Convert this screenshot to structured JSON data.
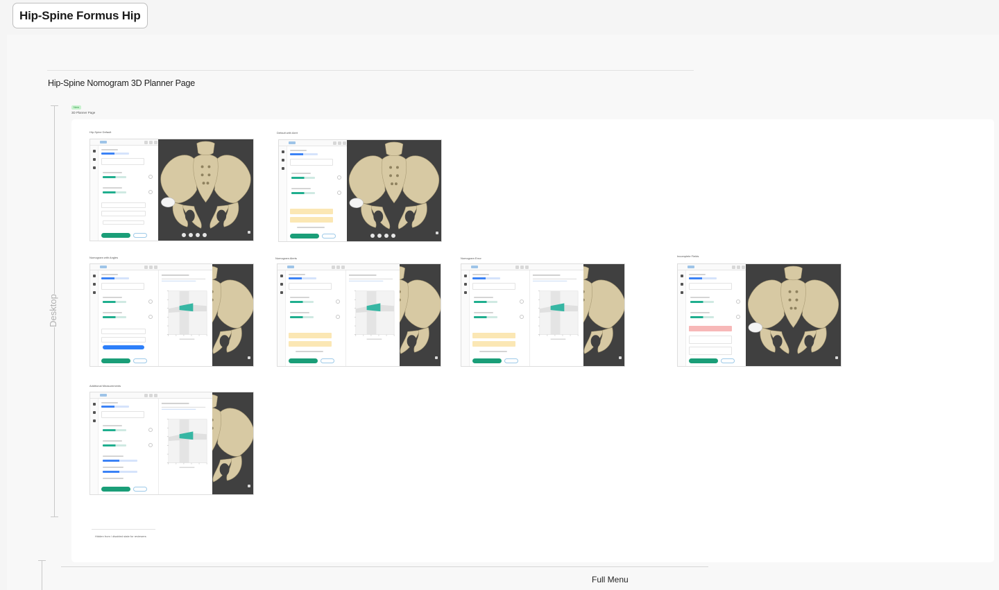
{
  "page": {
    "title": "Hip-Spine Formus Hip",
    "section_title": "Hip-Spine Nomogram 3D Planner Page",
    "vertical_label": "Desktop",
    "status_badge": "New",
    "page_label": "3D Planner Page",
    "footnote": "Hidden from / disabled state for reviewers",
    "next_section_label": "Full Menu"
  },
  "colors": {
    "accent_teal": "#1a9e78",
    "accent_blue": "#2d7ff9",
    "warning_yellow": "#fbe7b4",
    "error_red": "#f7b8b8",
    "viewer_bg": "#404040",
    "bone": "#d7c9a3"
  },
  "frames": [
    {
      "label": "Hip-Spine Default",
      "variant": "default"
    },
    {
      "label": "Default with Alert",
      "variant": "alerts"
    },
    {
      "label": "Nomogram with Angles",
      "variant": "nomogram"
    },
    {
      "label": "Nomogram Alerts",
      "variant": "nomogram-alerts"
    },
    {
      "label": "Nomogram Error",
      "variant": "nomogram-error"
    },
    {
      "label": "Incomplete Fields",
      "variant": "error"
    },
    {
      "label": "Additional Measurements",
      "variant": "nomogram-extra"
    }
  ],
  "icons": {
    "rail": [
      "cursor-icon",
      "pencil-icon",
      "home-icon"
    ],
    "viewer": [
      "rotate-icon",
      "zoom-icon",
      "reset-icon",
      "more-icon"
    ]
  }
}
